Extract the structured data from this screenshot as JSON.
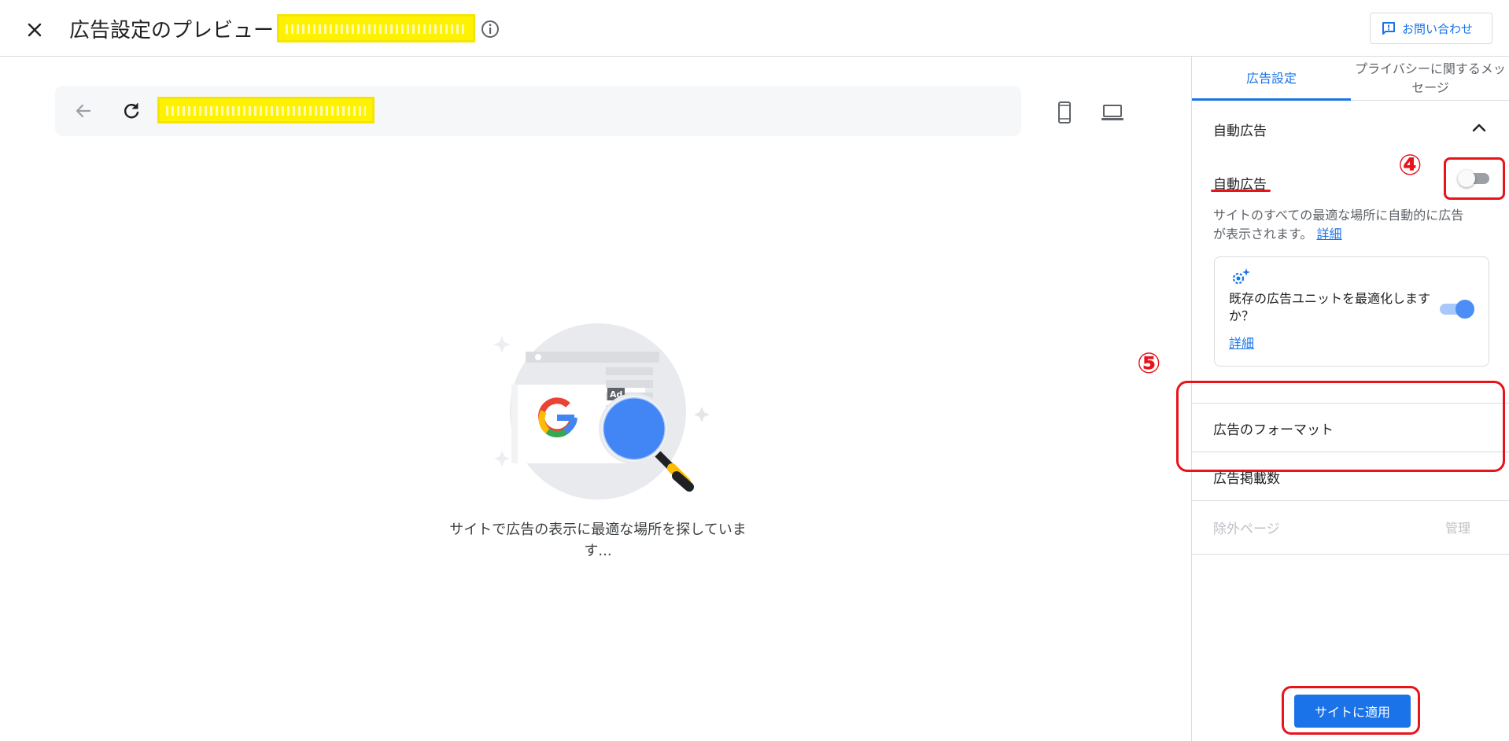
{
  "header": {
    "title": "広告設定のプレビュー |",
    "contact_label": "お問い合わせ"
  },
  "preview": {
    "loading_text": "サイトで広告の表示に最適な場所を探しています..."
  },
  "panel": {
    "tabs": [
      {
        "label": "広告設定",
        "active": true
      },
      {
        "label": "プライバシーに関するメッセージ",
        "active": false
      }
    ],
    "section_title": "自動広告",
    "auto_ads": {
      "label": "自動広告",
      "enabled": false,
      "description": "サイトのすべての最適な場所に自動的に広告が表示されます。",
      "details_link": "詳細"
    },
    "optimize": {
      "text": "既存の広告ユニットを最適化しますか？",
      "details_link": "詳細",
      "enabled": true
    },
    "rows": {
      "ad_formats": "広告のフォーマット",
      "ad_load": "広告掲載数",
      "excluded_pages": "除外ページ",
      "manage": "管理"
    },
    "apply_button": "サイトに適用"
  },
  "annotations": {
    "marker_4": "④",
    "marker_5": "⑤"
  },
  "colors": {
    "accent": "#1a73e8",
    "annotation_red": "#e8131b",
    "redaction_yellow": "#fff200"
  }
}
